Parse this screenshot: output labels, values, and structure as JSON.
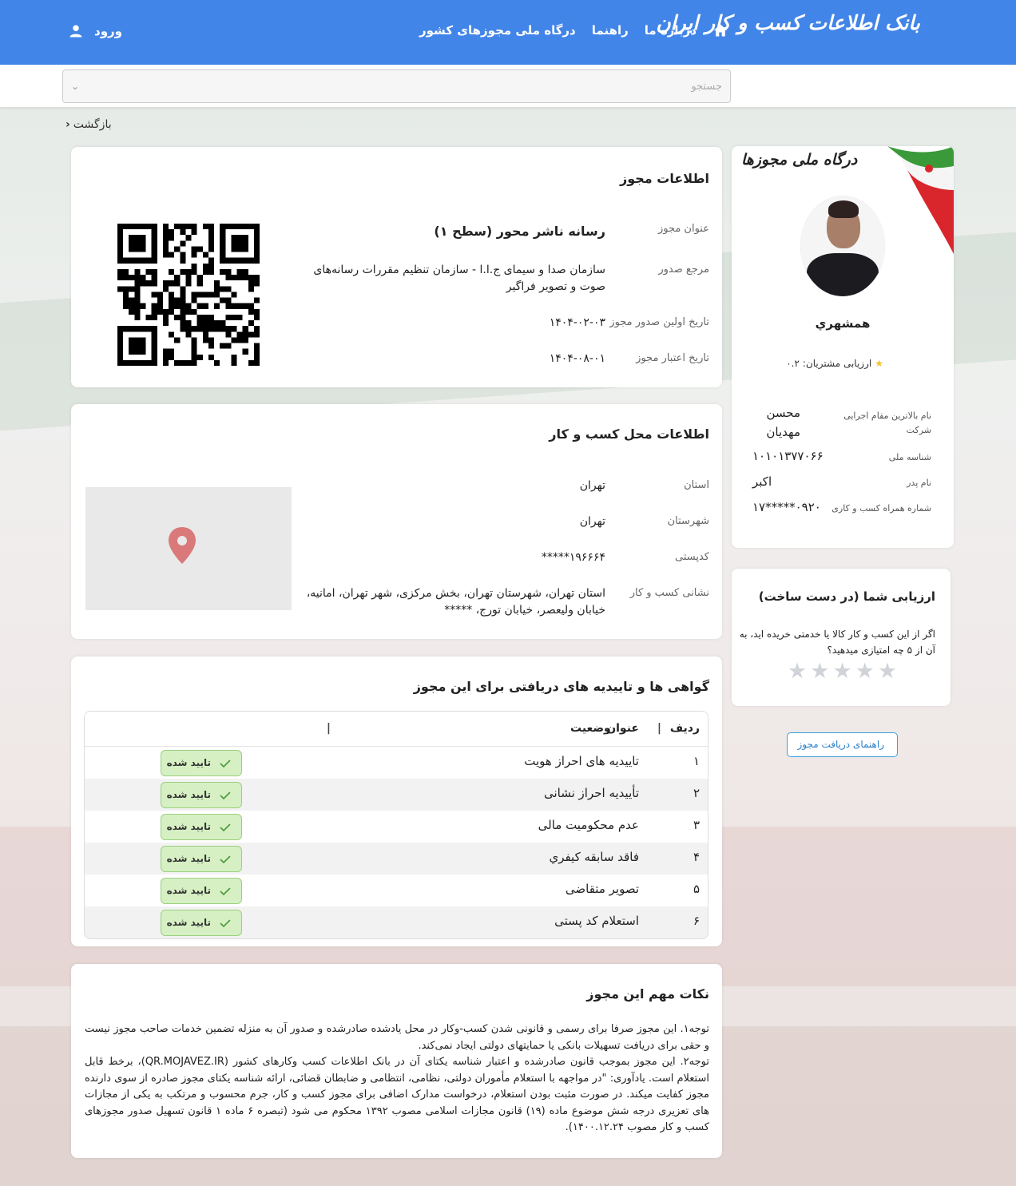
{
  "header": {
    "logo": "بانک اطلاعات کسب و کار ایران",
    "nav": [
      "درباره ما",
      "راهنما",
      "درگاه ملی مجوزهای کشور"
    ],
    "login": "ورود"
  },
  "search": {
    "placeholder": "جستجو"
  },
  "back": "بازگشت",
  "license": {
    "title": "اطلاعات مجوز",
    "rows": [
      {
        "label": "عنوان مجوز",
        "value": "رسانه ناشر محور (سطح ۱)"
      },
      {
        "label": "مرجع صدور",
        "value": "سازمان صدا و سیمای ج.ا.ا - سازمان تنظیم مقررات رسانه‌های صوت و تصویر فراگیر"
      },
      {
        "label": "تاریخ اولین صدور مجوز",
        "value": "۱۴۰۴-۰۲-۰۳"
      },
      {
        "label": "تاریخ اعتبار مجوز",
        "value": "۱۴۰۴-۰۸-۰۱"
      }
    ]
  },
  "location": {
    "title": "اطلاعات محل کسب و کار",
    "rows": [
      {
        "label": "استان",
        "value": "تهران"
      },
      {
        "label": "شهرستان",
        "value": "تهران"
      },
      {
        "label": "کدپستی",
        "value": "۱۹۶۶۶۴*****"
      },
      {
        "label": "نشانی کسب و کار",
        "value": "استان تهران، شهرستان تهران، بخش مرکزی، شهر تهران، امانیه، خیابان ولیعصر، خیابان تورج، *****"
      }
    ]
  },
  "certs": {
    "title": "گواهی ها و تاییدیه های دریافتی برای این مجوز",
    "headers": {
      "idx": "ردیف",
      "title": "عنوان",
      "status": "وضعیت"
    },
    "rows": [
      {
        "idx": "۱",
        "title": "تاییدیه های احراز هویت",
        "status": "تایید شده"
      },
      {
        "idx": "۲",
        "title": "تأییدیه احراز نشانی",
        "status": "تایید شده"
      },
      {
        "idx": "۳",
        "title": "عدم محکومیت مالی",
        "status": "تایید شده"
      },
      {
        "idx": "۴",
        "title": "فاقد سابقه کیفري",
        "status": "تایید شده"
      },
      {
        "idx": "۵",
        "title": "تصویر متقاضی",
        "status": "تایید شده"
      },
      {
        "idx": "۶",
        "title": "استعلام کد پستی",
        "status": "تایید شده"
      }
    ]
  },
  "notes": {
    "title": "نکات مهم این مجوز",
    "p1": "توجه۱. این مجوز صرفا برای رسمی و قانونی شدن کسب-وکار در محل یادشده صادرشده و صدور آن به منزله تضمین خدمات صاحب مجوز نیست و حقی برای دریافت تسهیلات بانکی یا حمایتهای دولتی ایجاد نمی‌کند.",
    "p2": "توجه۲. این مجوز بموجب قانون صادرشده و اعتبار شناسه یکتای آن در بانک اطلاعات کسب وکارهای کشور (QR.MOJAVEZ.IR)، برخط قابل استعلام است. یادآوری: \"در مواجهه با استعلام مأموران دولتی، نظامی، انتظامی و ضابطان قضائی، ارائه شناسه یکتای مجوز صادره از سوی دارنده مجوز کفایت میکند. در صورت مثبت بودن استعلام، درخواست مدارک اضافی برای مجوز کسب و کار، جرم محسوب و مرتکب به یکی از مجازات های تعزیری درجه شش موضوع ماده (۱۹) قانون مجازات اسلامی مصوب ۱۳۹۲ محکوم می شود (تبصره ۶ ماده ۱ قانون تسهیل صدور مجوزهای کسب و کار مصوب ۱۴۰۰.۱۲.۲۴)."
  },
  "profile": {
    "portal": "درگاه ملی مجوزها",
    "name": "همشهري",
    "rating_label": "ارزیابی مشتریان:",
    "rating": "۰.۲",
    "rows": [
      {
        "label": "نام بالاترین مقام اجرایی شرکت",
        "value": "محسن مهدیان"
      },
      {
        "label": "شناسه ملی",
        "value": "۱۰۱۰۱۳۷۷۰۶۶"
      },
      {
        "label": "نام پدر",
        "value": "اکبر"
      },
      {
        "label": "شماره همراه کسب و کاری",
        "value": "۰۹۲۰*****۱۷"
      }
    ]
  },
  "rate": {
    "title": "ارزیابی شما (در دست ساخت)",
    "text": "اگر از این کسب و کار کالا یا خدمتی خریده اید، به آن از ۵ چه امتیازی میدهید؟",
    "stars": 0
  },
  "guide": "راهنمای دریافت مجوز",
  "colors": {
    "primary": "#4285e8",
    "success_bg": "#d6f0c4",
    "pin": "#d9797a"
  }
}
